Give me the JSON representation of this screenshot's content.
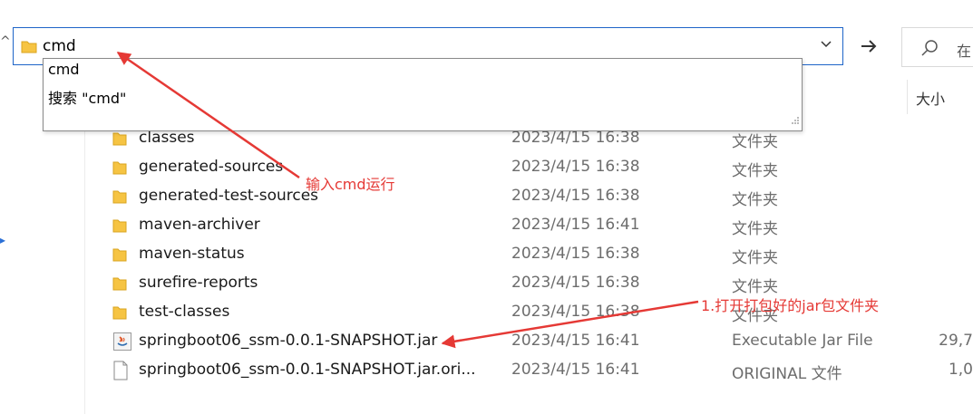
{
  "address": {
    "value": "cmd"
  },
  "search": {
    "placeholder": "在"
  },
  "suggestions": [
    "cmd",
    "搜索 \"cmd\""
  ],
  "columns": {
    "size_label": "大小"
  },
  "files": [
    {
      "name": "classes",
      "date": "2023/4/15 16:38",
      "type": "文件夹",
      "size": "",
      "icon": "folder-icon"
    },
    {
      "name": "generated-sources",
      "date": "2023/4/15 16:38",
      "type": "文件夹",
      "size": "",
      "icon": "folder-icon"
    },
    {
      "name": "generated-test-sources",
      "date": "2023/4/15 16:38",
      "type": "文件夹",
      "size": "",
      "icon": "folder-icon"
    },
    {
      "name": "maven-archiver",
      "date": "2023/4/15 16:41",
      "type": "文件夹",
      "size": "",
      "icon": "folder-icon"
    },
    {
      "name": "maven-status",
      "date": "2023/4/15 16:38",
      "type": "文件夹",
      "size": "",
      "icon": "folder-icon"
    },
    {
      "name": "surefire-reports",
      "date": "2023/4/15 16:38",
      "type": "文件夹",
      "size": "",
      "icon": "folder-icon"
    },
    {
      "name": "test-classes",
      "date": "2023/4/15 16:38",
      "type": "文件夹",
      "size": "",
      "icon": "folder-icon"
    },
    {
      "name": "springboot06_ssm-0.0.1-SNAPSHOT.jar",
      "date": "2023/4/15 16:41",
      "type": "Executable Jar File",
      "size": "29,7",
      "icon": "java-jar-icon"
    },
    {
      "name": "springboot06_ssm-0.0.1-SNAPSHOT.jar.ori...",
      "date": "2023/4/15 16:41",
      "type": "ORIGINAL 文件",
      "size": "1,0",
      "icon": "file-icon"
    }
  ],
  "annotations": {
    "cmd_note": "输入cmd运行",
    "jar_note": "1.打开打包好的jar包文件夹"
  },
  "colors": {
    "accent": "#1e64c8",
    "annotation": "#e53935",
    "folder": "#f6c443"
  }
}
